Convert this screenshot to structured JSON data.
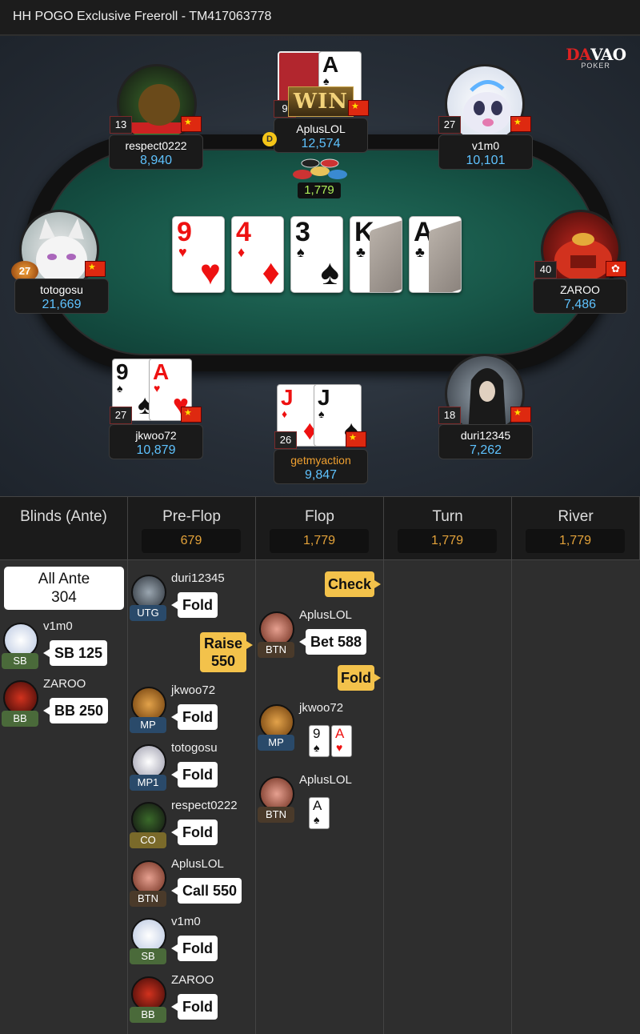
{
  "header": {
    "title": "HH  POGO Exclusive Freeroll    - TM417063778"
  },
  "logo": {
    "line1a": "DA",
    "line1b": "VAO",
    "line2": "POKER"
  },
  "pot": {
    "amount": "1,779"
  },
  "board": [
    {
      "rank": "9",
      "suit": "♥",
      "color": "red"
    },
    {
      "rank": "4",
      "suit": "♦",
      "color": "red"
    },
    {
      "rank": "3",
      "suit": "♠",
      "color": "blk"
    },
    {
      "rank": "K",
      "suit": "♣",
      "color": "blk"
    },
    {
      "rank": "A",
      "suit": "♣",
      "color": "blk"
    }
  ],
  "seats": {
    "respect0222": {
      "name": "respect0222",
      "stack": "8,940",
      "level": "13"
    },
    "aplus": {
      "name": "AplusLOL",
      "stack": "12,574",
      "level": "9",
      "win_badge": "WIN",
      "card_rank": "A",
      "card_suit": "♠"
    },
    "v1m0": {
      "name": "v1m0",
      "stack": "10,101",
      "level": "27"
    },
    "totogosu": {
      "name": "totogosu",
      "stack": "21,669",
      "level": "27"
    },
    "zaroo": {
      "name": "ZAROO",
      "stack": "7,486",
      "level": "40"
    },
    "jkwoo72": {
      "name": "jkwoo72",
      "stack": "10,879",
      "level": "27",
      "c1": "9",
      "c1s": "♠",
      "c2": "A",
      "c2s": "♥"
    },
    "getmyaction": {
      "name": "getmyaction",
      "stack": "9,847",
      "level": "26",
      "c1": "J",
      "c1s": "♦",
      "c2": "J",
      "c2s": "♠"
    },
    "duri12345": {
      "name": "duri12345",
      "stack": "7,262",
      "level": "18"
    }
  },
  "dealer_button": "D",
  "streets": [
    {
      "label": "Blinds (Ante)",
      "pot": ""
    },
    {
      "label": "Pre-Flop",
      "pot": "679"
    },
    {
      "label": "Flop",
      "pot": "1,779"
    },
    {
      "label": "Turn",
      "pot": "1,779"
    },
    {
      "label": "River",
      "pot": "1,779"
    }
  ],
  "blinds_col": {
    "ante_label": "All Ante",
    "ante_value": "304",
    "entries": [
      {
        "name": "v1m0",
        "pos": "SB",
        "action": "SB 125"
      },
      {
        "name": "ZAROO",
        "pos": "BB",
        "action": "BB 250"
      }
    ]
  },
  "preflop_col": {
    "raise_line1": "Raise",
    "raise_line2": "550",
    "entries": [
      {
        "name": "duri12345",
        "pos": "UTG",
        "action": "Fold"
      },
      {
        "name": "jkwoo72",
        "pos": "MP",
        "action": "Fold"
      },
      {
        "name": "totogosu",
        "pos": "MP1",
        "action": "Fold"
      },
      {
        "name": "respect0222",
        "pos": "CO",
        "action": "Fold"
      },
      {
        "name": "AplusLOL",
        "pos": "BTN",
        "action": "Call 550"
      },
      {
        "name": "v1m0",
        "pos": "SB",
        "action": "Fold"
      },
      {
        "name": "ZAROO",
        "pos": "BB",
        "action": "Fold"
      }
    ]
  },
  "flop_col": {
    "check_label": "Check",
    "fold_label": "Fold",
    "entries": [
      {
        "name": "AplusLOL",
        "pos": "BTN",
        "action": "Bet 588"
      },
      {
        "name": "jkwoo72",
        "pos": "MP",
        "c1": "9",
        "c1s": "♠",
        "c2": "A",
        "c2s": "♥"
      },
      {
        "name": "AplusLOL",
        "pos": "BTN",
        "c1": "A",
        "c1s": "♠"
      }
    ]
  }
}
